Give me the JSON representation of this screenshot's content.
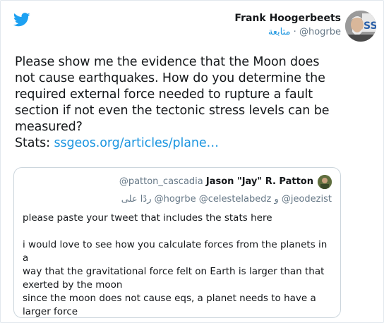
{
  "app": {
    "logo_icon": "twitter-bird-icon",
    "brand_color": "#1da1f2"
  },
  "author": {
    "name": "Frank Hoogerbeets",
    "follow_label": "متابعة",
    "separator": "·",
    "handle": "@hogrbe",
    "avatar_icon": "avatar"
  },
  "tweet": {
    "text_lines": [
      "Please show me the evidence that the Moon does",
      "not cause earthquakes. How do you determine the",
      "required external force needed to rupture a fault",
      "section if not even the tectonic stress levels can be",
      "measured?"
    ],
    "stats_label": "Stats: ",
    "stats_link": "ssgeos.org/articles/plane…"
  },
  "quote": {
    "handle": "@patton_cascadia",
    "name": "Jason \"Jay\" R. Patton",
    "reply_line": "ردًا على @hogrbe @celestelabedz و @jeodezist",
    "body": [
      "please paste your tweet that includes the stats here",
      "",
      "i would love to see how you calculate forces from the planets in a",
      "way that the gravitational force felt on Earth is larger than that",
      "exerted by the moon",
      "since the moon does not cause eqs, a planet needs to have a",
      "larger force"
    ]
  }
}
